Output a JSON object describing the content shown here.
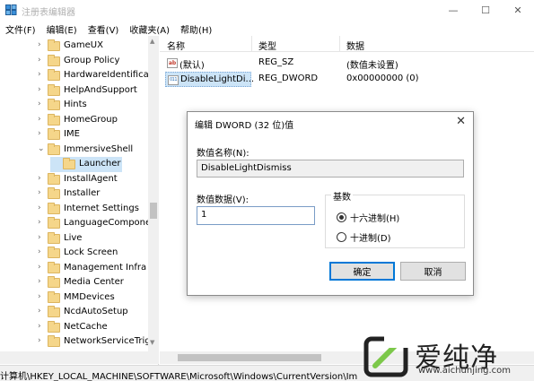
{
  "window": {
    "title": "注册表编辑器",
    "minimize": "—",
    "maximize": "☐",
    "close": "✕"
  },
  "menu": [
    "文件(F)",
    "编辑(E)",
    "查看(V)",
    "收藏夹(A)",
    "帮助(H)"
  ],
  "tree": {
    "items": [
      {
        "label": "GameUX",
        "expanded": false
      },
      {
        "label": "Group Policy",
        "expanded": false
      },
      {
        "label": "HardwareIdentifica",
        "expanded": false
      },
      {
        "label": "HelpAndSupport",
        "expanded": false
      },
      {
        "label": "Hints",
        "expanded": false
      },
      {
        "label": "HomeGroup",
        "expanded": false
      },
      {
        "label": "IME",
        "expanded": false
      },
      {
        "label": "ImmersiveShell",
        "expanded": true
      },
      {
        "label": "Launcher",
        "child": true,
        "selected": true
      },
      {
        "label": "InstallAgent",
        "expanded": false
      },
      {
        "label": "Installer",
        "expanded": false
      },
      {
        "label": "Internet Settings",
        "expanded": false
      },
      {
        "label": "LanguageCompone",
        "expanded": false
      },
      {
        "label": "Live",
        "expanded": false
      },
      {
        "label": "Lock Screen",
        "expanded": false
      },
      {
        "label": "Management Infra",
        "expanded": false
      },
      {
        "label": "Media Center",
        "expanded": false
      },
      {
        "label": "MMDevices",
        "expanded": false
      },
      {
        "label": "NcdAutoSetup",
        "expanded": false
      },
      {
        "label": "NetCache",
        "expanded": false
      },
      {
        "label": "NetworkServiceTrig",
        "expanded": false
      }
    ]
  },
  "list": {
    "columns": [
      "名称",
      "类型",
      "数据"
    ],
    "rows": [
      {
        "icon": "ab",
        "name": "(默认)",
        "type": "REG_SZ",
        "data": "(数值未设置)"
      },
      {
        "icon": "011",
        "name": "DisableLightDi...",
        "type": "REG_DWORD",
        "data": "0x00000000 (0)"
      }
    ]
  },
  "status": "计算机\\HKEY_LOCAL_MACHINE\\SOFTWARE\\Microsoft\\Windows\\CurrentVersion\\Im",
  "dialog": {
    "title": "编辑 DWORD (32 位)值",
    "close": "✕",
    "name_label": "数值名称(N):",
    "name_value": "DisableLightDismiss",
    "data_label": "数值数据(V):",
    "data_value": "1",
    "base_label": "基数",
    "base_hex": "十六进制(H)",
    "base_dec": "十进制(D)",
    "base_selected": "hex",
    "ok": "确定",
    "cancel": "取消"
  },
  "watermark": {
    "text": "爱纯净",
    "url": "www.aichunjing.com"
  }
}
